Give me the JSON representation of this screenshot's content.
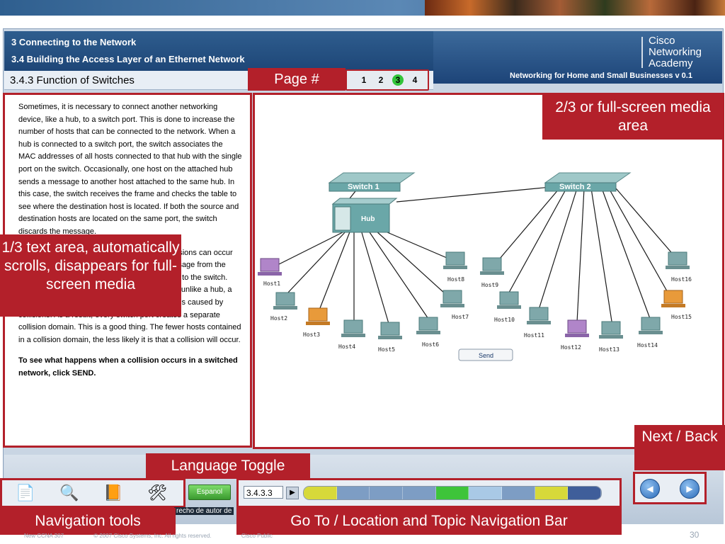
{
  "header": {
    "chapter_title": "3 Connecting to the Network",
    "section_title": "3.4 Building the Access Layer of an Ethernet Network",
    "topic_title": "3.4.3 Function of Switches",
    "logo_lines": [
      "Cisco",
      "Networking",
      "Academy"
    ],
    "course_name": "Networking for Home and Small Businesses v 0.1"
  },
  "pages": {
    "items": [
      "1",
      "2",
      "3",
      "4"
    ],
    "active": "3"
  },
  "body": {
    "paragraphs": [
      "Sometimes, it is necessary to connect another networking device, like a hub, to a switch port. This is done to increase the number of hosts that can be connected to the network. When a hub is connected to a switch port, the switch associates the MAC addresses of all hosts connected to that hub with the single port on the switch. Occasionally, one host on the attached hub sends a message to another host attached to the same hub. In this case, the switch receives the frame and checks the table to see where the destination host is located. If both the source and destination hosts are located on the same port, the switch discards the message.",
      "When a hub is connected to a switch port, collisions can occur on the hub. The hub forwards the garbled message from the collision to all ports, including the port attached to the switch. The switch receives the garbled message, but, unlike a hub, a switch does not forward the damaged messages caused by collisions. As a result, every switch port creates a separate collision domain. This is a good thing. The fewer hosts contained in a collision domain, the less likely it is that a collision will occur."
    ],
    "instruction": "To see what happens when a collision occurs in a switched network, click SEND."
  },
  "diagram": {
    "switch1_label": "Switch 1",
    "switch2_label": "Switch 2",
    "hub_label": "Hub",
    "send_label": "Send",
    "hosts": [
      "Host1",
      "Host2",
      "Host3",
      "Host4",
      "Host5",
      "Host6",
      "Host7",
      "Host8",
      "Host9",
      "Host10",
      "Host11",
      "Host12",
      "Host13",
      "Host14",
      "Host15",
      "Host16"
    ]
  },
  "callouts": {
    "page": "Page #",
    "media": "2/3 or full-screen media area",
    "text": "1/3 text area, automatically scrolls, disappears for full-screen media",
    "nextback": "Next / Back",
    "language": "Language Toggle",
    "navtools": "Navigation tools",
    "goto": "Go To / Location and Topic Navigation Bar"
  },
  "toolbar": {
    "espanol_label": "Espanol",
    "location_value": "3.4.3.3",
    "copyright_fragment": "recho de autor de",
    "topic_segment_colors": [
      "#d7d93a",
      "#7d9dc4",
      "#7d9dc4",
      "#7d9dc4",
      "#3ec43a",
      "#a9c9e6",
      "#7d9dc4",
      "#d7d93a",
      "#3f5e9a"
    ]
  },
  "footer": {
    "left": "New CCNA 307",
    "copyright": "© 2007 Cisco Systems, Inc. All rights reserved.",
    "classification": "Cisco Public",
    "slide_number": "30"
  },
  "colors": {
    "callout": "#b3202a",
    "header": "#1e4677",
    "active_page": "#33c43a"
  }
}
